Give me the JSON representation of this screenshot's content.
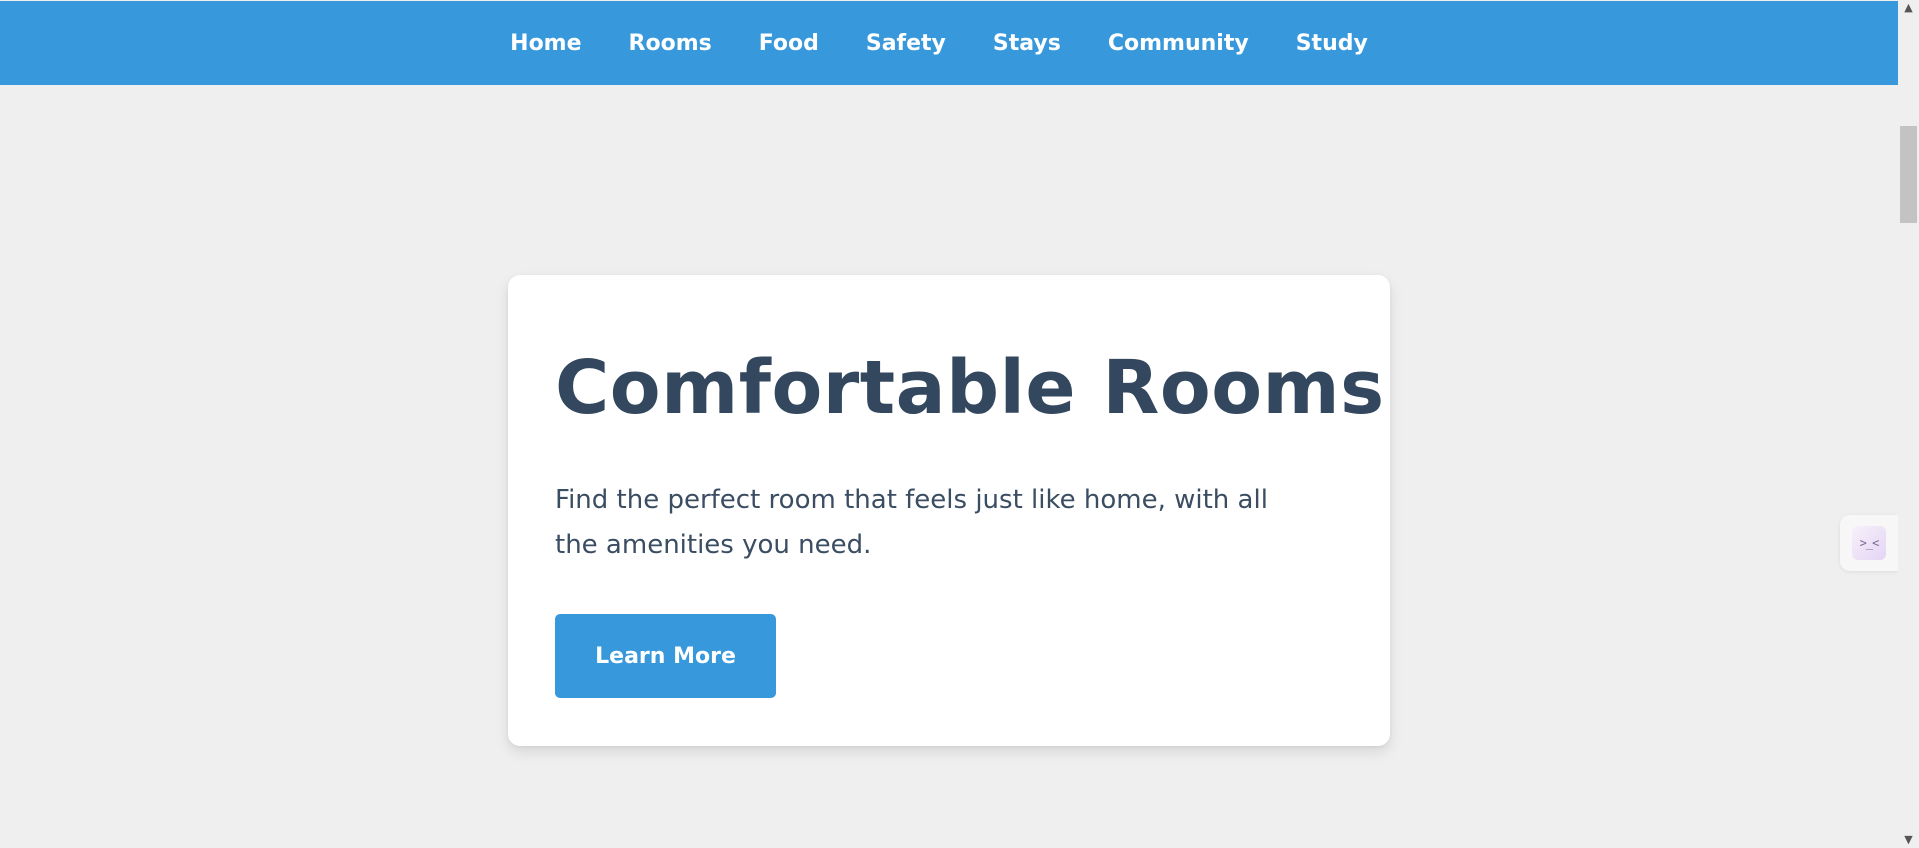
{
  "nav": {
    "items": [
      {
        "label": "Home"
      },
      {
        "label": "Rooms"
      },
      {
        "label": "Food"
      },
      {
        "label": "Safety"
      },
      {
        "label": "Stays"
      },
      {
        "label": "Community"
      },
      {
        "label": "Study"
      }
    ]
  },
  "hero": {
    "title": "Comfortable Rooms",
    "description": "Find the perfect room that feels just like home, with all the amenities you need.",
    "button_label": "Learn More"
  },
  "side_widget": {
    "icon_name": "extension-face-icon",
    "glyph": ">_<"
  },
  "scrollbar": {
    "up_glyph": "▲",
    "down_glyph": "▼"
  },
  "colors": {
    "accent": "#3799dc",
    "page_background": "#efefef",
    "card_background": "#ffffff",
    "heading_text": "#33475e"
  }
}
